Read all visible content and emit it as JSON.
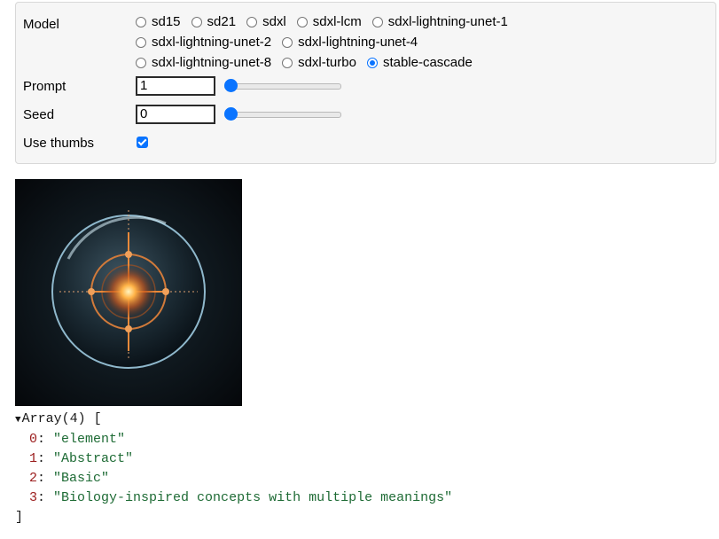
{
  "controls": {
    "model_label": "Model",
    "models": [
      {
        "label": "sd15",
        "checked": false
      },
      {
        "label": "sd21",
        "checked": false
      },
      {
        "label": "sdxl",
        "checked": false
      },
      {
        "label": "sdxl-lcm",
        "checked": false
      },
      {
        "label": "sdxl-lightning-unet-1",
        "checked": false
      },
      {
        "label": "sdxl-lightning-unet-2",
        "checked": false
      },
      {
        "label": "sdxl-lightning-unet-4",
        "checked": false
      },
      {
        "label": "sdxl-lightning-unet-8",
        "checked": false
      },
      {
        "label": "sdxl-turbo",
        "checked": false
      },
      {
        "label": "stable-cascade",
        "checked": true
      }
    ],
    "prompt_label": "Prompt",
    "prompt_value": "1",
    "prompt_slider_fraction": 0,
    "seed_label": "Seed",
    "seed_value": "0",
    "seed_slider_fraction": 0,
    "use_thumbs_label": "Use thumbs",
    "use_thumbs_checked": true,
    "accent_color": "#0a74ff"
  },
  "image": {
    "icon": "glowing-orb-image"
  },
  "console": {
    "header": "Array(4) [",
    "expanded": true,
    "items": [
      {
        "index": "0",
        "value": "\"element\""
      },
      {
        "index": "1",
        "value": "\"Abstract\""
      },
      {
        "index": "2",
        "value": "\"Basic\""
      },
      {
        "index": "3",
        "value": "\"Biology-inspired concepts with multiple meanings\""
      }
    ],
    "close": "]"
  }
}
